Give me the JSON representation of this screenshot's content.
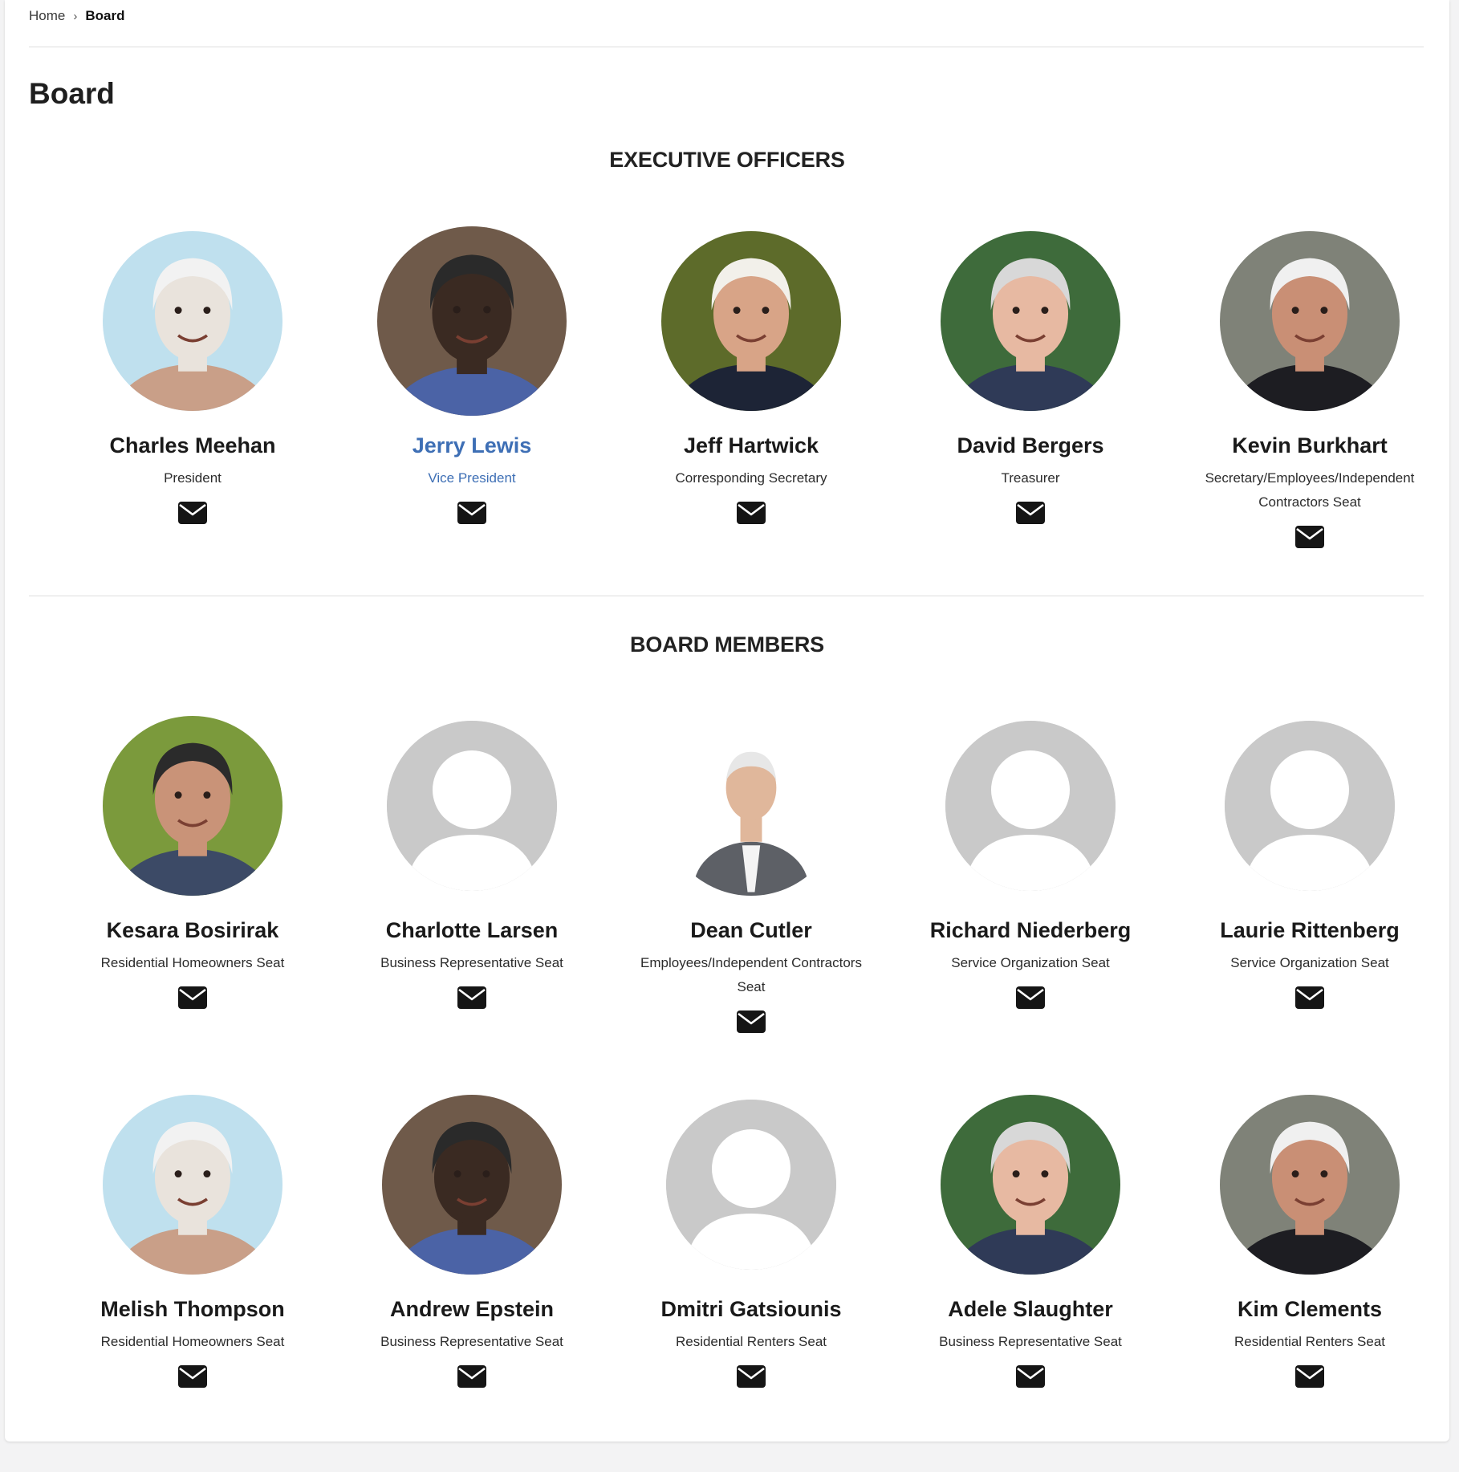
{
  "breadcrumb": {
    "home": "Home",
    "separator": "›",
    "current": "Board"
  },
  "page_title": "Board",
  "sections": {
    "executive": {
      "heading": "EXECUTIVE OFFICERS",
      "members": [
        {
          "name": "Charles Meehan",
          "role": "President",
          "photo": "photo",
          "highlighted": false
        },
        {
          "name": "Jerry Lewis",
          "role": "Vice President",
          "photo": "photo",
          "highlighted": true
        },
        {
          "name": "Jeff Hartwick",
          "role": "Corresponding Secretary",
          "photo": "photo",
          "highlighted": false
        },
        {
          "name": "David Bergers",
          "role": "Treasurer",
          "photo": "photo",
          "highlighted": false
        },
        {
          "name": "Kevin Burkhart",
          "role": "Secretary/Employees/Independent Contractors Seat",
          "photo": "photo",
          "highlighted": false
        }
      ]
    },
    "board": {
      "heading": "BOARD MEMBERS",
      "members": [
        {
          "name": "Kesara Bosirirak",
          "role": "Residential Homeowners Seat",
          "photo": "photo"
        },
        {
          "name": "Charlotte Larsen",
          "role": "Business Representative Seat",
          "photo": "placeholder"
        },
        {
          "name": "Dean Cutler",
          "role": "Employees/Independent Contractors Seat",
          "photo": "photo"
        },
        {
          "name": "Richard Niederberg",
          "role": "Service Organization Seat",
          "photo": "placeholder"
        },
        {
          "name": "Laurie Rittenberg",
          "role": "Service Organization Seat",
          "photo": "placeholder"
        },
        {
          "name": "Melish Thompson",
          "role": "Residential Homeowners Seat",
          "photo": "photo"
        },
        {
          "name": "Andrew Epstein",
          "role": "Business Representative Seat",
          "photo": "photo"
        },
        {
          "name": "Dmitri Gatsiounis",
          "role": "Residential Renters Seat",
          "photo": "placeholder"
        },
        {
          "name": "Adele Slaughter",
          "role": "Business Representative Seat",
          "photo": "photo"
        },
        {
          "name": "Kim Clements",
          "role": "Residential Renters Seat",
          "photo": "photo"
        }
      ]
    }
  },
  "icons": {
    "email": "envelope-icon",
    "placeholder_avatar": "user-placeholder-icon"
  },
  "colors": {
    "accent": "#3e6fb5",
    "text": "#1a1a1a",
    "placeholder_gray": "#c9c9c9",
    "rule": "#dedede"
  }
}
